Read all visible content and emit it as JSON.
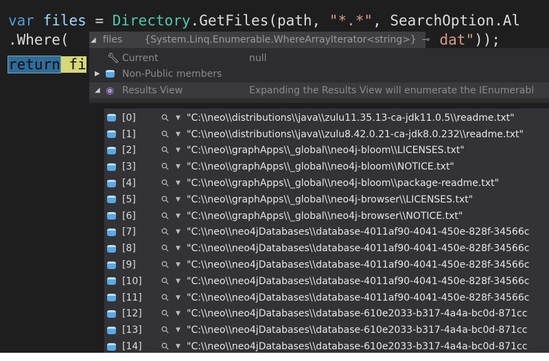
{
  "code": {
    "line1": {
      "kw": "var",
      "id": "files",
      "eq": " = ",
      "type": "Directory",
      "rest": ".GetFiles(path, ",
      "str": "\"*.*\"",
      "rest2": ", SearchOption.Al"
    },
    "line2": {
      "start": ".Where(",
      "end_str": "dat\"",
      "end": "));"
    },
    "line3": {
      "ret": "return",
      "rest": "fi"
    }
  },
  "tooltip": {
    "name": "files",
    "value": "{System.Linq.Enumerable.WhereArrayIterator<string>}"
  },
  "members": [
    {
      "name": "Current",
      "value": "null",
      "icon": "wrench-icon"
    },
    {
      "name": "Non-Public members",
      "value": "",
      "icon": "cube-icon"
    },
    {
      "name": "Results View",
      "value": "Expanding the Results View will enumerate the IEnumerabl",
      "icon": "results-icon"
    }
  ],
  "results": [
    {
      "index": "[0]",
      "value": "\"C:\\\\neo\\\\distributions\\\\java\\\\zulu11.35.13-ca-jdk11.0.5\\\\readme.txt\""
    },
    {
      "index": "[1]",
      "value": "\"C:\\\\neo\\\\distributions\\\\java\\\\zulu8.42.0.21-ca-jdk8.0.232\\\\readme.txt\""
    },
    {
      "index": "[2]",
      "value": "\"C:\\\\neo\\\\graphApps\\\\_global\\\\neo4j-bloom\\\\LICENSES.txt\""
    },
    {
      "index": "[3]",
      "value": "\"C:\\\\neo\\\\graphApps\\\\_global\\\\neo4j-bloom\\\\NOTICE.txt\""
    },
    {
      "index": "[4]",
      "value": "\"C:\\\\neo\\\\graphApps\\\\_global\\\\neo4j-bloom\\\\package-readme.txt\""
    },
    {
      "index": "[5]",
      "value": "\"C:\\\\neo\\\\graphApps\\\\_global\\\\neo4j-browser\\\\LICENSES.txt\""
    },
    {
      "index": "[6]",
      "value": "\"C:\\\\neo\\\\graphApps\\\\_global\\\\neo4j-browser\\\\NOTICE.txt\""
    },
    {
      "index": "[7]",
      "value": "\"C:\\\\neo\\\\neo4jDatabases\\\\database-4011af90-4041-450e-828f-34566c"
    },
    {
      "index": "[8]",
      "value": "\"C:\\\\neo\\\\neo4jDatabases\\\\database-4011af90-4041-450e-828f-34566c"
    },
    {
      "index": "[9]",
      "value": "\"C:\\\\neo\\\\neo4jDatabases\\\\database-4011af90-4041-450e-828f-34566c"
    },
    {
      "index": "[10]",
      "value": "\"C:\\\\neo\\\\neo4jDatabases\\\\database-4011af90-4041-450e-828f-34566c"
    },
    {
      "index": "[11]",
      "value": "\"C:\\\\neo\\\\neo4jDatabases\\\\database-4011af90-4041-450e-828f-34566c"
    },
    {
      "index": "[12]",
      "value": "\"C:\\\\neo\\\\neo4jDatabases\\\\database-610e2033-b317-4a4a-bc0d-871cc"
    },
    {
      "index": "[13]",
      "value": "\"C:\\\\neo\\\\neo4jDatabases\\\\database-610e2033-b317-4a4a-bc0d-871cc"
    },
    {
      "index": "[14]",
      "value": "\"C:\\\\neo\\\\neo4jDatabases\\\\database-610e2033-b317-4a4a-bc0d-871cc"
    }
  ]
}
